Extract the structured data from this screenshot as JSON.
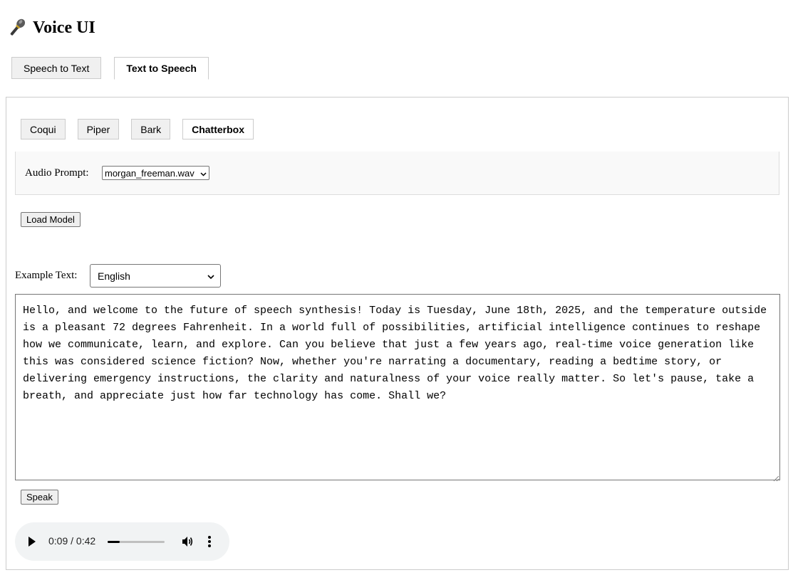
{
  "app": {
    "title": "Voice UI",
    "icon": "microphone-icon"
  },
  "main_tabs": [
    {
      "label": "Speech to Text",
      "active": false
    },
    {
      "label": "Text to Speech",
      "active": true
    }
  ],
  "engine_tabs": [
    {
      "label": "Coqui",
      "active": false
    },
    {
      "label": "Piper",
      "active": false
    },
    {
      "label": "Bark",
      "active": false
    },
    {
      "label": "Chatterbox",
      "active": true
    }
  ],
  "audio_prompt": {
    "label": "Audio Prompt:",
    "selected": "morgan_freeman.wav"
  },
  "load_model": {
    "label": "Load Model"
  },
  "example_text": {
    "label": "Example Text:",
    "selected": "English"
  },
  "text_input": {
    "value": "Hello, and welcome to the future of speech synthesis! Today is Tuesday, June 18th, 2025, and the temperature outside is a pleasant 72 degrees Fahrenheit. In a world full of possibilities, artificial intelligence continues to reshape how we communicate, learn, and explore. Can you believe that just a few years ago, real-time voice generation like this was considered science fiction? Now, whether you're narrating a documentary, reading a bedtime story, or delivering emergency instructions, the clarity and naturalness of your voice really matter. So let's pause, take a breath, and appreciate just how far technology has come. Shall we?"
  },
  "speak": {
    "label": "Speak"
  },
  "audio_player": {
    "time": "0:09 / 0:42",
    "progress_fraction": 0.214
  }
}
